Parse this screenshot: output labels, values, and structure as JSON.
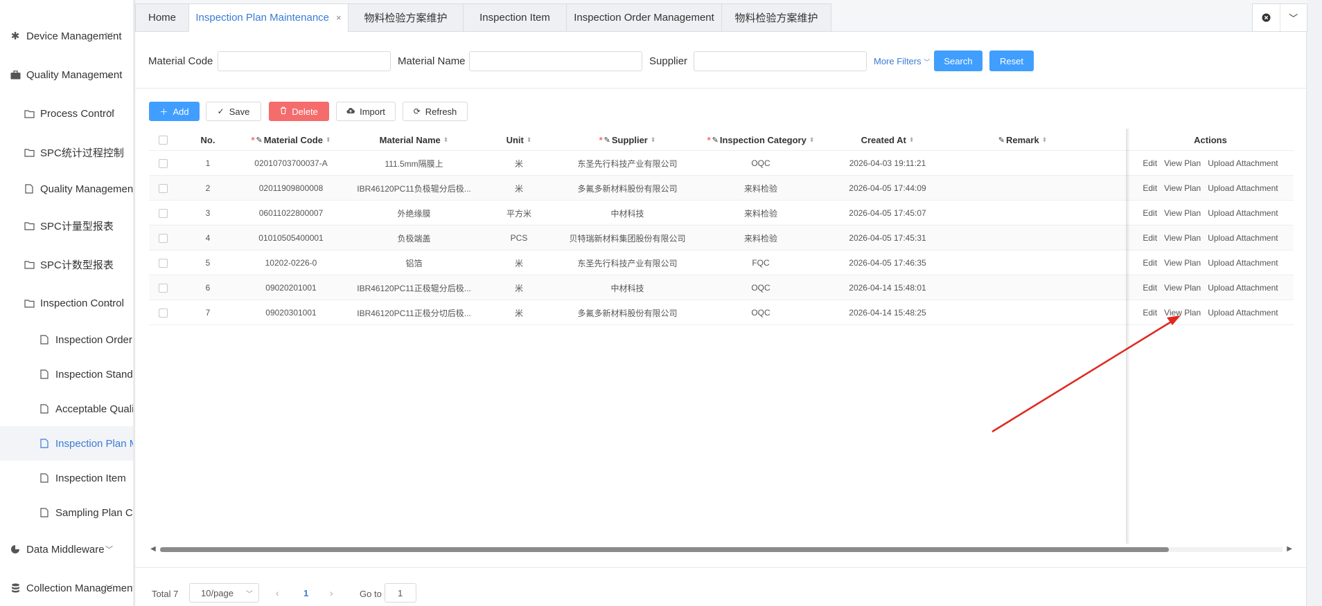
{
  "sidebar": {
    "items": [
      {
        "label": "Device Management",
        "icon": "asterisk-icon"
      },
      {
        "label": "Quality Management",
        "icon": "briefcase-icon"
      },
      {
        "label": "Process Control",
        "icon": "folder-icon"
      },
      {
        "label": "SPC统计过程控制",
        "icon": "folder-icon"
      },
      {
        "label": "Quality Management I",
        "icon": "file-icon"
      },
      {
        "label": "SPC计量型报表",
        "icon": "folder-icon"
      },
      {
        "label": "SPC计数型报表",
        "icon": "folder-icon"
      },
      {
        "label": "Inspection Control",
        "icon": "folder-icon"
      },
      {
        "label": "Inspection Order M",
        "icon": "file-icon"
      },
      {
        "label": "Inspection Standar",
        "icon": "file-icon"
      },
      {
        "label": "Acceptable Quality",
        "icon": "file-icon"
      },
      {
        "label": "Inspection Plan Ma",
        "icon": "file-icon"
      },
      {
        "label": "Inspection Item",
        "icon": "file-icon"
      },
      {
        "label": "Sampling Plan Con",
        "icon": "file-icon"
      },
      {
        "label": "Data Middleware",
        "icon": "pie-chart-icon"
      },
      {
        "label": "Collection Management",
        "icon": "database-icon"
      }
    ]
  },
  "tabs": [
    {
      "label": "Home"
    },
    {
      "label": "Inspection Plan Maintenance",
      "close": "×"
    },
    {
      "label": "物料检验方案维护"
    },
    {
      "label": "Inspection Item"
    },
    {
      "label": "Inspection Order Management"
    },
    {
      "label": "物料检验方案维护"
    }
  ],
  "filter": {
    "material_code_label": "Material Code",
    "material_name_label": "Material Name",
    "supplier_label": "Supplier",
    "more_filters": "More Filters",
    "search": "Search",
    "reset": "Reset"
  },
  "toolbar": {
    "add": "Add",
    "save": "Save",
    "delete": "Delete",
    "import": "Import",
    "refresh": "Refresh"
  },
  "table": {
    "headers": {
      "no": "No.",
      "material_code": "Material Code",
      "material_name": "Material Name",
      "unit": "Unit",
      "supplier": "Supplier",
      "inspection_category": "Inspection Category",
      "created_at": "Created At",
      "remark": "Remark",
      "actions": "Actions"
    },
    "actions": {
      "edit": "Edit",
      "view_plan": "View Plan",
      "upload": "Upload Attachment"
    },
    "rows": [
      {
        "no": "1",
        "code": "02010703700037-A",
        "name": "111.5mm隔膜上",
        "unit": "米",
        "supplier": "东圣先行科技产业有限公司",
        "category": "OQC",
        "created": "2026-04-03 19:11:21",
        "remark": ""
      },
      {
        "no": "2",
        "code": "02011909800008",
        "name": "IBR46120PC11负极辊分后极...",
        "unit": "米",
        "supplier": "多氟多新材料股份有限公司",
        "category": "来料检验",
        "created": "2026-04-05 17:44:09",
        "remark": ""
      },
      {
        "no": "3",
        "code": "06011022800007",
        "name": "外绝缘膜",
        "unit": "平方米",
        "supplier": "中材科技",
        "category": "来料检验",
        "created": "2026-04-05 17:45:07",
        "remark": ""
      },
      {
        "no": "4",
        "code": "01010505400001",
        "name": "负极端盖",
        "unit": "PCS",
        "supplier": "贝特瑞新材料集团股份有限公司",
        "category": "来料检验",
        "created": "2026-04-05 17:45:31",
        "remark": ""
      },
      {
        "no": "5",
        "code": "10202-0226-0",
        "name": "铝箔",
        "unit": "米",
        "supplier": "东圣先行科技产业有限公司",
        "category": "FQC",
        "created": "2026-04-05 17:46:35",
        "remark": ""
      },
      {
        "no": "6",
        "code": "09020201001",
        "name": "IBR46120PC11正极辊分后极...",
        "unit": "米",
        "supplier": "中材科技",
        "category": "OQC",
        "created": "2026-04-14 15:48:01",
        "remark": ""
      },
      {
        "no": "7",
        "code": "09020301001",
        "name": "IBR46120PC11正极分切后极...",
        "unit": "米",
        "supplier": "多氟多新材料股份有限公司",
        "category": "OQC",
        "created": "2026-04-14 15:48:25",
        "remark": ""
      }
    ]
  },
  "pagination": {
    "total": "Total 7",
    "page_size": "10/page",
    "current_page": "1",
    "goto_label": "Go to",
    "goto_value": "1"
  },
  "colors": {
    "accent": "#409eff",
    "danger": "#f56c6c",
    "annotation_arrow": "#e0281e"
  }
}
